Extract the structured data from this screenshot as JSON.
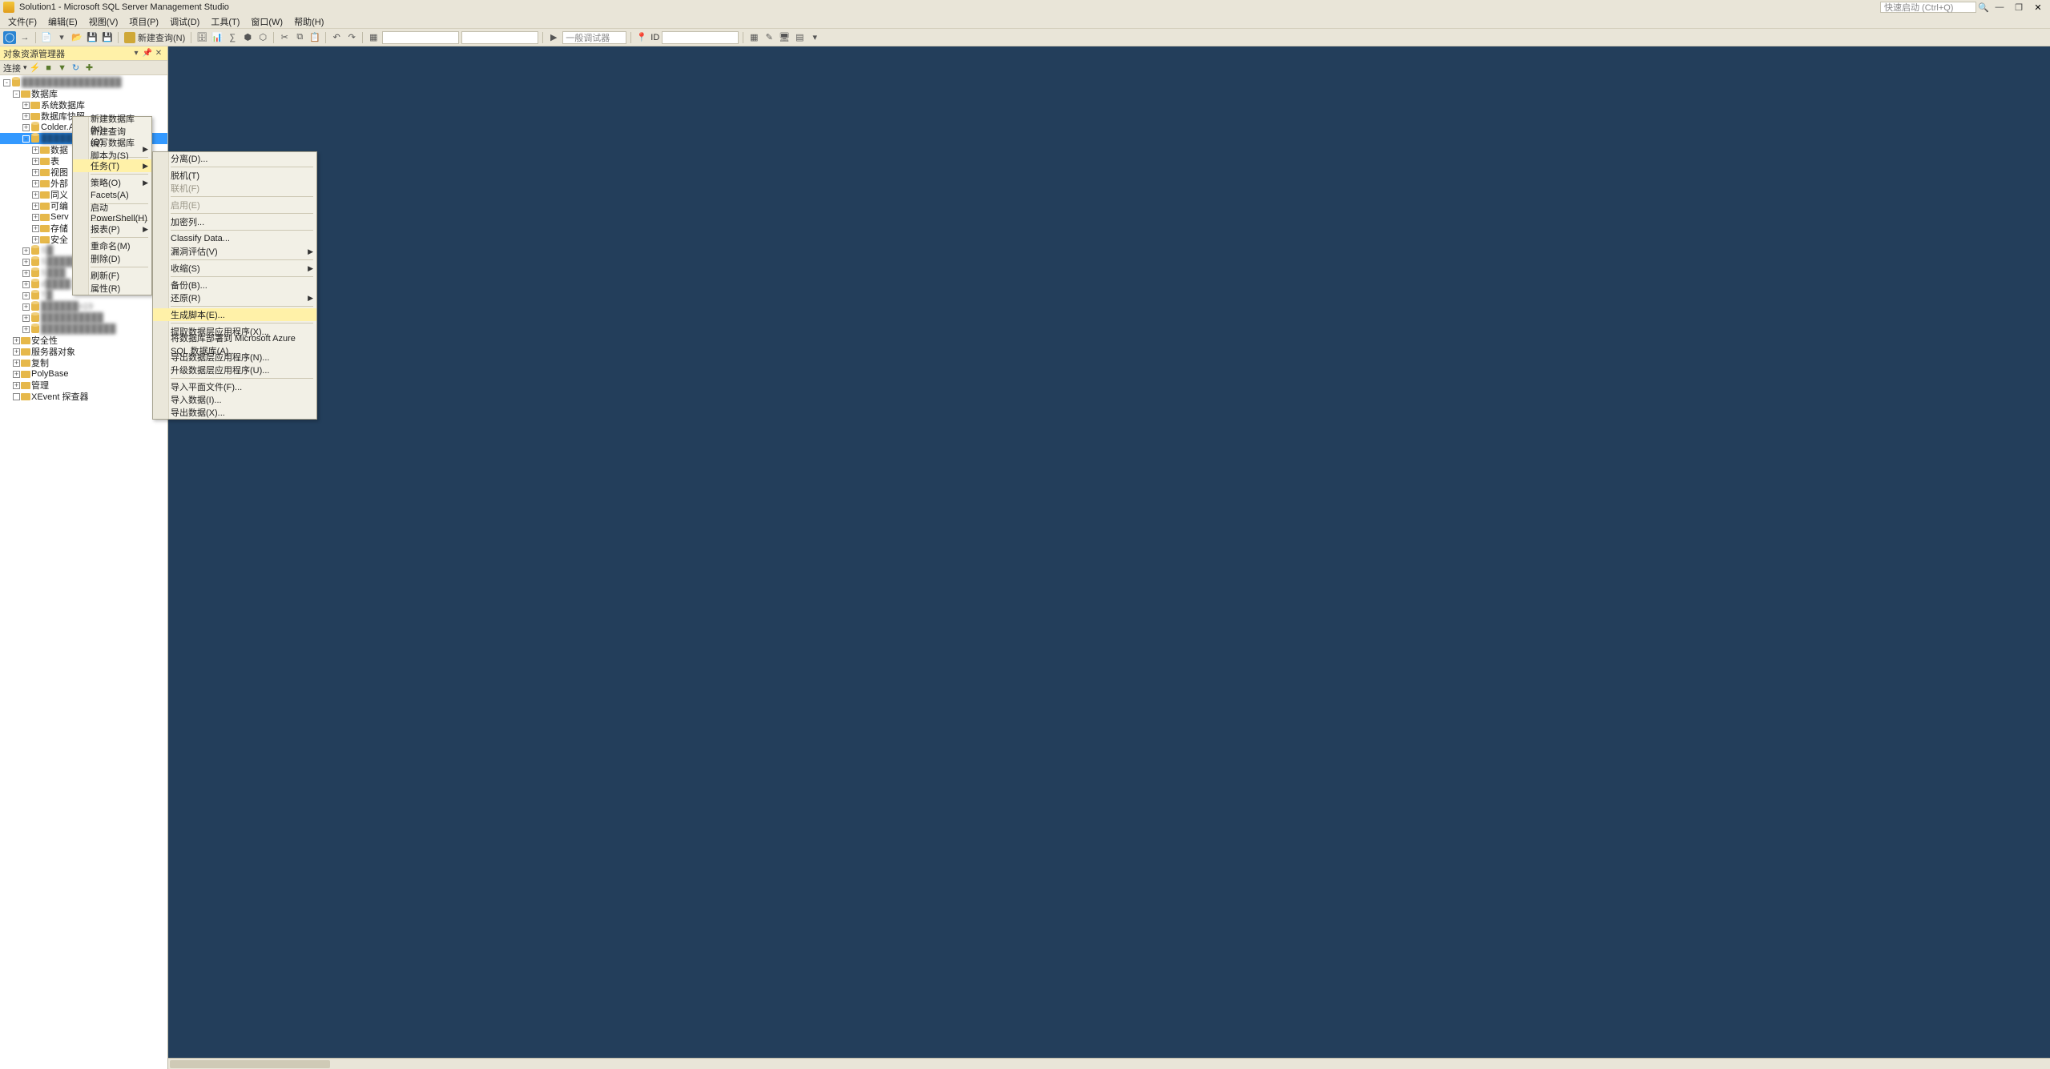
{
  "titlebar": {
    "title": "Solution1 - Microsoft SQL Server Management Studio",
    "quicklaunch_placeholder": "快速启动 (Ctrl+Q)"
  },
  "menubar": {
    "items": [
      "文件(F)",
      "编辑(E)",
      "视图(V)",
      "项目(P)",
      "调试(D)",
      "工具(T)",
      "窗口(W)",
      "帮助(H)"
    ]
  },
  "toolbar": {
    "new_query": "新建查询(N)",
    "debug_combo": "一般调试器",
    "id_label": "ID"
  },
  "object_explorer": {
    "title": "对象资源管理器",
    "connect_label": "连接",
    "root_blur": "████████████████",
    "nodes": {
      "databases": "数据库",
      "system_db": "系统数据库",
      "db_snapshot": "数据库快照",
      "db_colder": "Colder.Admin.AntdVue",
      "db_selected_blur": "████████",
      "sub": [
        "数据",
        "表",
        "视图",
        "外部",
        "同义",
        "可编",
        "Serv",
        "存储",
        "安全"
      ],
      "other_db_blur": [
        "S█",
        "S█████",
        "S███",
        "d████",
        "T█",
        "██████n19",
        "██████████",
        "████████████"
      ],
      "security": "安全性",
      "server_obj": "服务器对象",
      "replication": "复制",
      "polybase": "PolyBase",
      "management": "管理",
      "xevent": "XEvent 探查器"
    }
  },
  "ctx1": {
    "items": [
      {
        "t": "新建数据库(N)..."
      },
      {
        "t": "新建查询(Q)"
      },
      {
        "t": "编写数据库脚本为(S)",
        "sub": true
      },
      {
        "sep": true
      },
      {
        "t": "任务(T)",
        "sub": true,
        "hl": true
      },
      {
        "sep": true
      },
      {
        "t": "策略(O)",
        "sub": true
      },
      {
        "t": "Facets(A)"
      },
      {
        "sep": true
      },
      {
        "t": "启动 PowerShell(H)"
      },
      {
        "sep": true
      },
      {
        "t": "报表(P)",
        "sub": true
      },
      {
        "sep": true
      },
      {
        "t": "重命名(M)"
      },
      {
        "t": "删除(D)"
      },
      {
        "sep": true
      },
      {
        "t": "刷新(F)"
      },
      {
        "t": "属性(R)"
      }
    ]
  },
  "ctx2": {
    "items": [
      {
        "t": "分离(D)..."
      },
      {
        "sep": true
      },
      {
        "t": "脱机(T)"
      },
      {
        "t": "联机(F)",
        "dis": true
      },
      {
        "sep": true
      },
      {
        "t": "启用(E)",
        "dis": true
      },
      {
        "sep": true
      },
      {
        "t": "加密列..."
      },
      {
        "sep": true
      },
      {
        "t": "Classify Data..."
      },
      {
        "t": "漏洞评估(V)",
        "sub": true
      },
      {
        "sep": true
      },
      {
        "t": "收缩(S)",
        "sub": true
      },
      {
        "sep": true
      },
      {
        "t": "备份(B)..."
      },
      {
        "t": "还原(R)",
        "sub": true
      },
      {
        "sep": true
      },
      {
        "t": "生成脚本(E)...",
        "hl": true
      },
      {
        "sep": true
      },
      {
        "t": "提取数据层应用程序(X)..."
      },
      {
        "t": "将数据库部署到 Microsoft Azure SQL 数据库(A)..."
      },
      {
        "t": "导出数据层应用程序(N)..."
      },
      {
        "t": "升级数据层应用程序(U)..."
      },
      {
        "sep": true
      },
      {
        "t": "导入平面文件(F)..."
      },
      {
        "t": "导入数据(I)..."
      },
      {
        "t": "导出数据(X)..."
      }
    ]
  }
}
